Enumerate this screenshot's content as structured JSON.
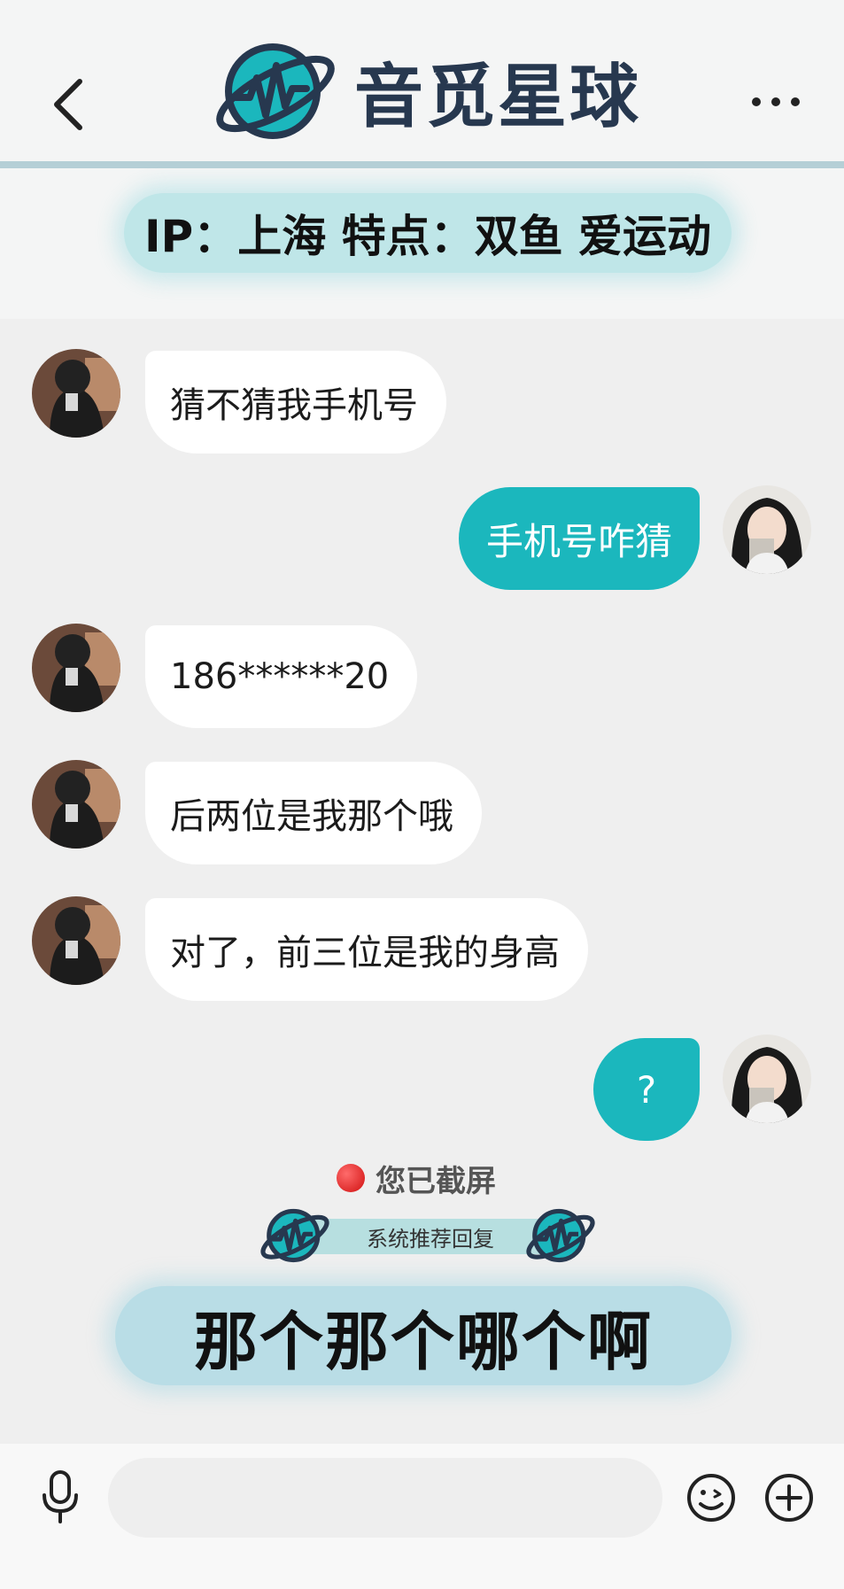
{
  "header": {
    "app_name": "音觅星球",
    "brand_color": "#27384f",
    "accent_color": "#1bb7bd",
    "back_icon": "chevron-left-icon",
    "more_icon": "more-dots-icon"
  },
  "info_banner": {
    "text": "IP：上海 特点：双鱼 爱运动"
  },
  "messages": [
    {
      "side": "incoming",
      "text": "猜不猜我手机号"
    },
    {
      "side": "outgoing",
      "text": "手机号咋猜"
    },
    {
      "side": "incoming",
      "text": "186******20"
    },
    {
      "side": "incoming",
      "text": "后两位是我那个哦"
    },
    {
      "side": "incoming",
      "text": "对了，前三位是我的身高"
    },
    {
      "side": "outgoing",
      "text": "?"
    }
  ],
  "screenshot_notice": "您已截屏",
  "suggest": {
    "label": "系统推荐回复",
    "reply": "那个那个哪个啊"
  },
  "input_bar": {
    "value": "",
    "mic_icon": "microphone-icon",
    "emoji_icon": "emoji-icon",
    "plus_icon": "plus-icon"
  }
}
